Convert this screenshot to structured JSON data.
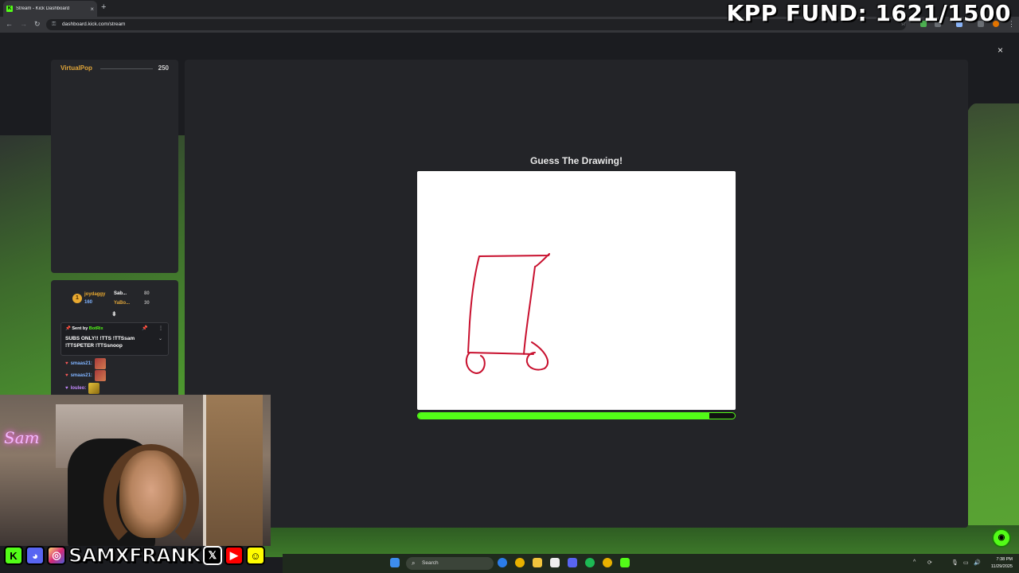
{
  "browser": {
    "tab_title": "Stream - Kick Dashboard",
    "tab_favicon": "K",
    "tab_close": "×",
    "new_tab": "+",
    "url": "dashboard.kick.com/stream"
  },
  "overlay": {
    "fund_text": "KPP FUND: 1621/1500",
    "neon_sign": "Sam"
  },
  "poll_panel": {
    "name": "VirtualPop",
    "value": "250"
  },
  "chat": {
    "leaderboard": [
      {
        "rank": "1",
        "name": "joydaggy",
        "amount": "160"
      },
      {
        "name": "Sab...",
        "amount": "80"
      },
      {
        "name": "YaBo...",
        "amount": "30"
      }
    ],
    "pinned": {
      "sent_by_label": "Sent by",
      "bot_name": "BotRix",
      "message": "SUBS ONLY!! !TTS !TTSsam !TTSPETER !TTSsnoop"
    },
    "messages": [
      {
        "user": "smaas21:",
        "color": "#7fb3ff"
      },
      {
        "user": "smaas21:",
        "color": "#7fb3ff"
      },
      {
        "user": "louleo:",
        "color": "#c58aff"
      }
    ]
  },
  "game": {
    "title": "Guess The Drawing!",
    "timer_progress_percent": 92,
    "close_label": "×",
    "stroke_color": "#c8102e"
  },
  "socials": {
    "handle": "SAMXFRANK",
    "icons": [
      "kick-icon",
      "discord-icon",
      "instagram-icon",
      "x-icon",
      "youtube-icon",
      "snapchat-icon"
    ]
  },
  "taskbar": {
    "search_label": "Search",
    "time": "7:38 PM",
    "date": "11/29/2025"
  },
  "colors": {
    "kick_green": "#53fc18",
    "panel_bg": "#25262a",
    "accent_gold": "#e0a53a"
  }
}
